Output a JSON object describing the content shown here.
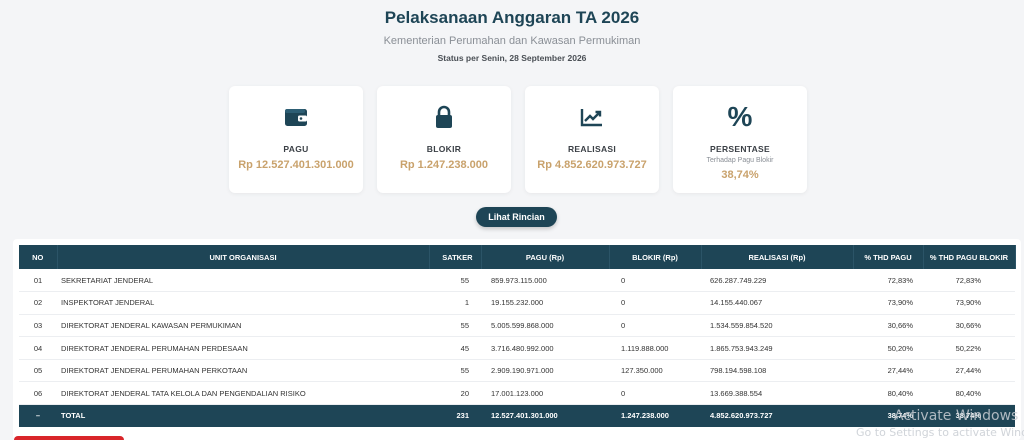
{
  "header": {
    "title": "Pelaksanaan Anggaran TA 2026",
    "subtitle": "Kementerian Perumahan dan Kawasan Permukiman",
    "status": "Status per Senin, 28 September 2026"
  },
  "cards": [
    {
      "icon": "wallet-icon",
      "label": "PAGU",
      "sub": "",
      "value": "Rp 12.527.401.301.000"
    },
    {
      "icon": "lock-icon",
      "label": "BLOKIR",
      "sub": "",
      "value": "Rp 1.247.238.000"
    },
    {
      "icon": "chart-line-icon",
      "label": "REALISASI",
      "sub": "",
      "value": "Rp 4.852.620.973.727"
    },
    {
      "icon": "percent-icon",
      "label": "PERSENTASE",
      "sub": "Terhadap Pagu Blokir",
      "value": "38,74%"
    }
  ],
  "button": {
    "label": "Lihat Rincian"
  },
  "table": {
    "headers": [
      "NO",
      "UNIT ORGANISASI",
      "SATKER",
      "PAGU (Rp)",
      "BLOKIR (Rp)",
      "REALISASI (Rp)",
      "% THD PAGU",
      "% THD PAGU BLOKIR"
    ],
    "rows": [
      [
        "01",
        "SEKRETARIAT JENDERAL",
        "55",
        "859.973.115.000",
        "0",
        "626.287.749.229",
        "72,83%",
        "72,83%"
      ],
      [
        "02",
        "INSPEKTORAT JENDERAL",
        "1",
        "19.155.232.000",
        "0",
        "14.155.440.067",
        "73,90%",
        "73,90%"
      ],
      [
        "03",
        "DIREKTORAT JENDERAL KAWASAN PERMUKIMAN",
        "55",
        "5.005.599.868.000",
        "0",
        "1.534.559.854.520",
        "30,66%",
        "30,66%"
      ],
      [
        "04",
        "DIREKTORAT JENDERAL PERUMAHAN PERDESAAN",
        "45",
        "3.716.480.992.000",
        "1.119.888.000",
        "1.865.753.943.249",
        "50,20%",
        "50,22%"
      ],
      [
        "05",
        "DIREKTORAT JENDERAL PERUMAHAN PERKOTAAN",
        "55",
        "2.909.190.971.000",
        "127.350.000",
        "798.194.598.108",
        "27,44%",
        "27,44%"
      ],
      [
        "06",
        "DIREKTORAT JENDERAL TATA KELOLA DAN PENGENDALIAN RISIKO",
        "20",
        "17.001.123.000",
        "0",
        "13.669.388.554",
        "80,40%",
        "80,40%"
      ]
    ],
    "total": [
      "–",
      "TOTAL",
      "231",
      "12.527.401.301.000",
      "1.247.238.000",
      "4.852.620.973.727",
      "38,74%",
      "38,74%"
    ]
  },
  "watermark": {
    "line1": "Activate Windows",
    "line2": "Go to Settings to activate Windows."
  },
  "colors": {
    "primary": "#1e4556",
    "accent": "#c9a26c",
    "background": "#f4f5f7"
  }
}
